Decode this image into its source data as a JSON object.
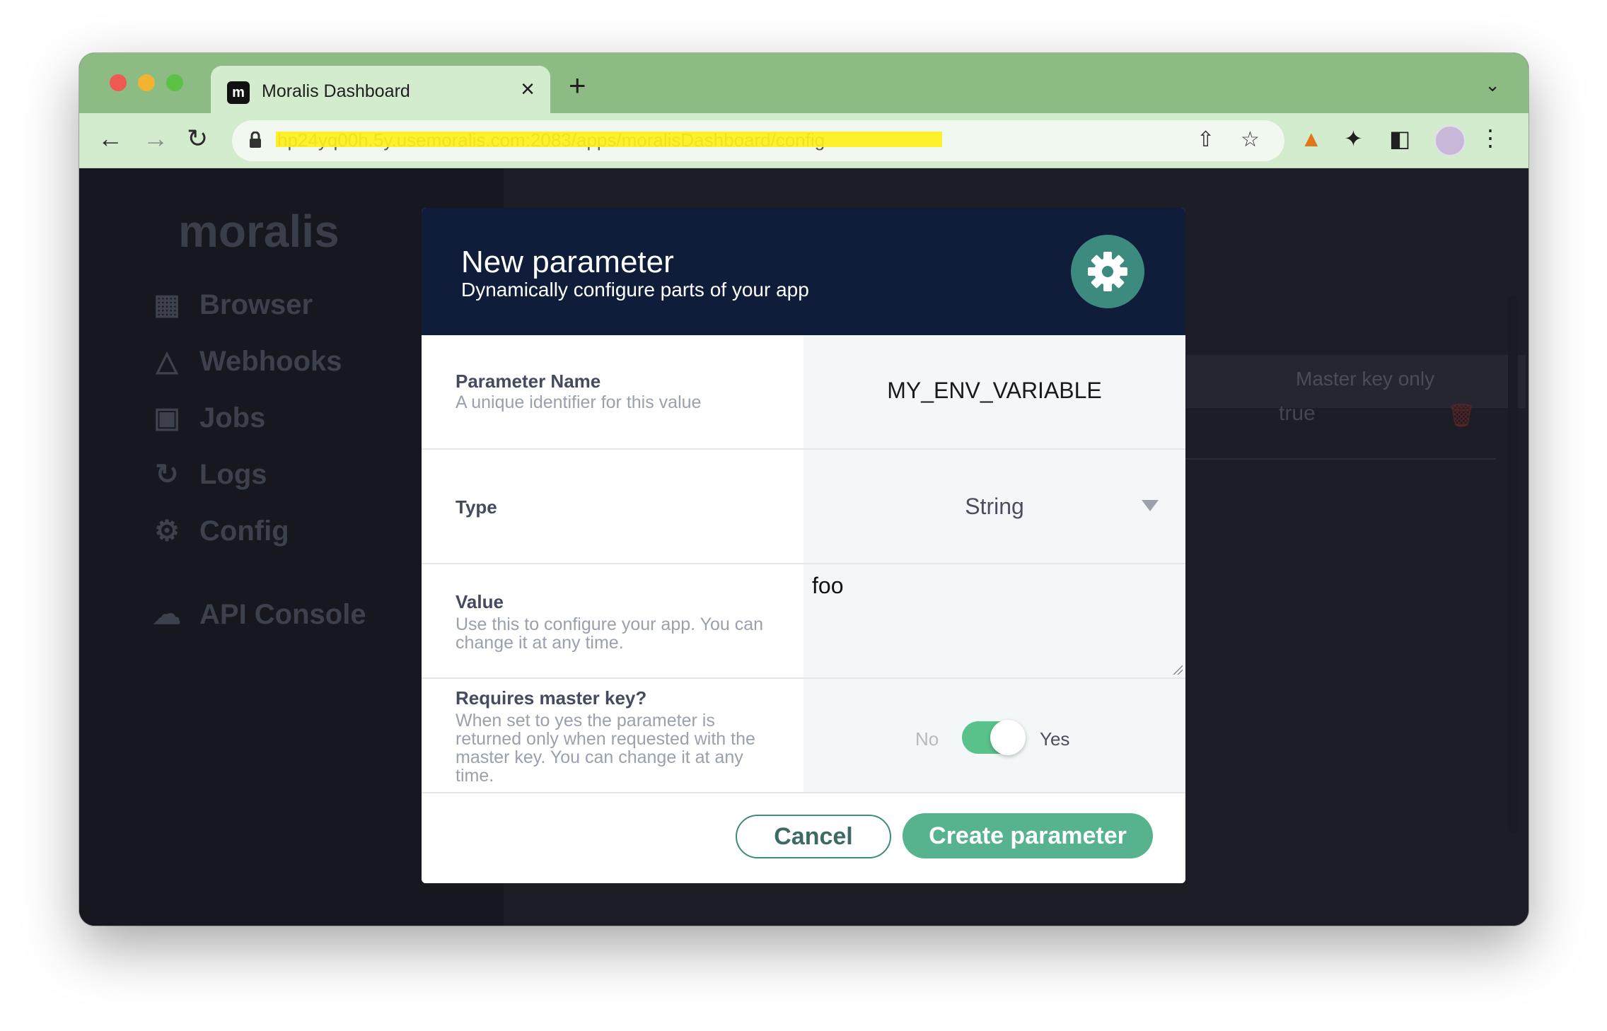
{
  "browser": {
    "tab_title": "Moralis Dashboard",
    "tab_close": "×",
    "new_tab": "+",
    "url": "hp24yq00h.5y.usemoralis.com:2083/apps/moralisDashboard/config"
  },
  "sidebar": {
    "logo_text": "moralis",
    "items": [
      {
        "label": "Browser",
        "icon": "grid-icon"
      },
      {
        "label": "Webhooks",
        "icon": "webhook-icon"
      },
      {
        "label": "Jobs",
        "icon": "jobs-icon"
      },
      {
        "label": "Logs",
        "icon": "refresh-icon"
      },
      {
        "label": "Config",
        "icon": "gear-icon"
      },
      {
        "label": "API Console",
        "icon": "cloud-icon"
      }
    ]
  },
  "background_table": {
    "column_header": "Master key only",
    "row_value": "true"
  },
  "modal": {
    "title": "New parameter",
    "subtitle": "Dynamically configure parts of your app",
    "fields": {
      "name": {
        "label": "Parameter Name",
        "description": "A unique identifier for this value",
        "value": "MY_ENV_VARIABLE"
      },
      "type": {
        "label": "Type",
        "value": "String"
      },
      "value": {
        "label": "Value",
        "description": "Use this to configure your app. You can change it at any time.",
        "value": "foo"
      },
      "master_key": {
        "label": "Requires master key?",
        "description": "When set to yes the parameter is returned only when requested with the master key. You can change it at any time.",
        "no_label": "No",
        "yes_label": "Yes",
        "enabled": true
      }
    },
    "cancel_label": "Cancel",
    "create_label": "Create parameter"
  },
  "colors": {
    "accent": "#56b38e",
    "modal_header": "#0f1d3a",
    "chrome": "#8dbb84"
  }
}
